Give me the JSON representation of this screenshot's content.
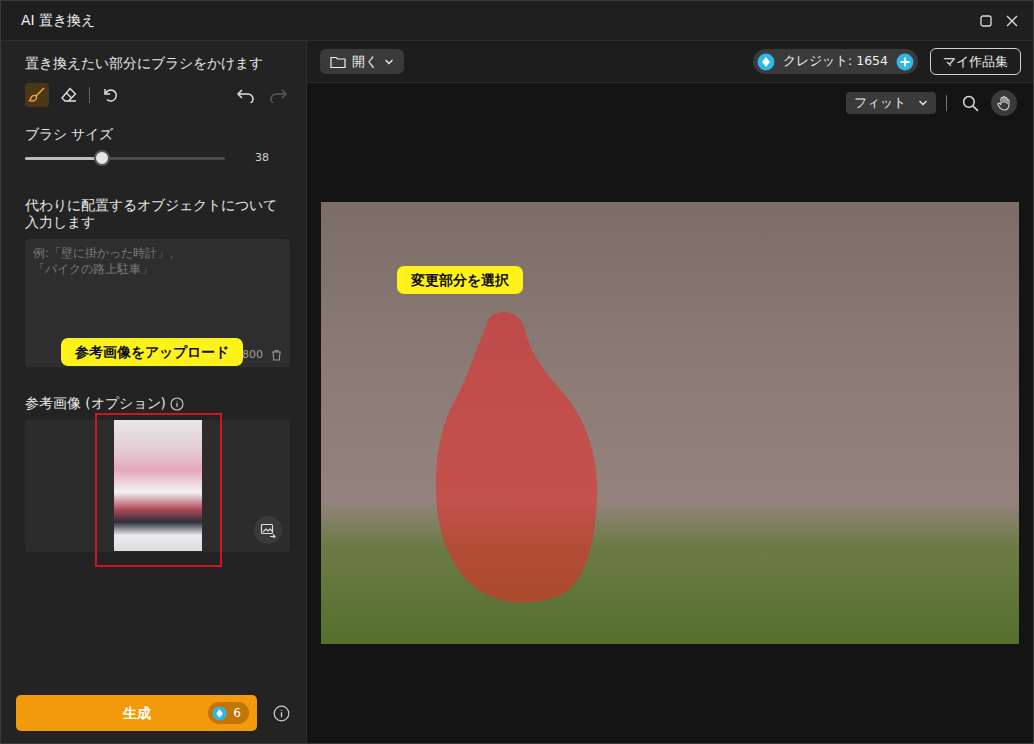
{
  "window": {
    "title": "AI 置き換え"
  },
  "left_panel": {
    "instruction": "置き換えたい部分にブラシをかけます",
    "tools": [
      {
        "kind": "brush",
        "selected": true
      },
      {
        "kind": "eraser",
        "selected": false
      }
    ],
    "history": {
      "undo_disabled": false,
      "redo_disabled": true
    },
    "brush_size": {
      "label": "ブラシ サイズ",
      "level": 0.385,
      "reading": "38"
    },
    "prompt": {
      "label": "代わりに配置するオブジェクトについて入力します",
      "placeholder": "例:「壁に掛かった時計」、\n「バイクの路上駐車」",
      "count": "0 / 800"
    },
    "reference": {
      "label": "参考画像 (オプション)"
    },
    "generate": {
      "label": "生成",
      "cost": "6"
    }
  },
  "toolbar": {
    "open": "開く",
    "credits": "クレジット: 1654",
    "gallery": "マイ作品集",
    "zoom": "フィット"
  },
  "annotations": [
    {
      "text": "変更部分を選択"
    },
    {
      "text": "参考画像をアップロード"
    }
  ]
}
